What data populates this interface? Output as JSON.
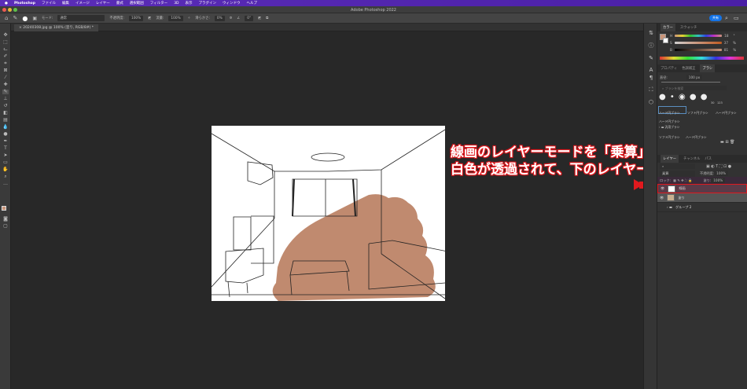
{
  "menubar": {
    "app": "Photoshop",
    "items": [
      "ファイル",
      "編集",
      "イメージ",
      "レイヤー",
      "書式",
      "選択範囲",
      "フィルター",
      "3D",
      "表示",
      "プラグイン",
      "ウィンドウ",
      "ヘルプ"
    ]
  },
  "window": {
    "title": "Adobe Photoshop 2022"
  },
  "options": {
    "mode_label": "モード:",
    "mode_value": "通常",
    "opacity_label": "不透明度:",
    "opacity_value": "100%",
    "flow_label": "流量:",
    "flow_value": "100%",
    "smoothing_label": "滑らかさ:",
    "smoothing_value": "0%",
    "angle": "0°",
    "share": "共有"
  },
  "document": {
    "tab": "20240308.jpg @ 100% (塗り, RGB/8#) *"
  },
  "color_panel": {
    "tabs": [
      "カラー",
      "スウォッチ"
    ],
    "h_label": "H",
    "h": "18",
    "h_unit": "°",
    "s_label": "S",
    "s": "37",
    "s_unit": "%",
    "b_label": "B",
    "b": "81",
    "b_unit": "%",
    "foreground": "#c9957a"
  },
  "brush_panel": {
    "tabs": [
      "プロパティ",
      "色調補正",
      "ブラシ"
    ],
    "size_label": "直径:",
    "size": "100 px",
    "search_placeholder": "ブラシを検索",
    "tip_sizes": [
      "30",
      "123"
    ],
    "presets": [
      "ハード円ブラシ",
      "ソフト円ブラシ",
      "ハード円ブラシ",
      "ハード円ブラシ"
    ],
    "folder": "汎用ブラシ",
    "presets2": [
      "ソフト円ブラシ",
      "ハード円ブラシ"
    ]
  },
  "layers_panel": {
    "tabs": [
      "レイヤー",
      "チャンネル",
      "パス"
    ],
    "blend": "乗算",
    "opacity_label": "不透明度:",
    "opacity": "100%",
    "lock_label": "ロック:",
    "fill_label": "塗り:",
    "fill": "100%",
    "layers": [
      {
        "name": "線画"
      },
      {
        "name": "塗り"
      },
      {
        "name": "グループ 2"
      }
    ]
  },
  "annotation": {
    "line1": "線画のレイヤーモードを「乗算」にすると",
    "line2": "白色が透過されて、下のレイヤーが見える"
  },
  "colors": {
    "accent": "#1473e6",
    "highlight": "#e0191e",
    "paint": "#c08a6f"
  }
}
